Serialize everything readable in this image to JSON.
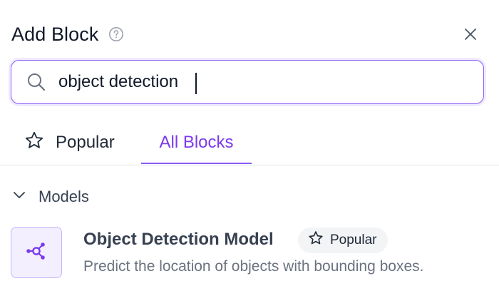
{
  "dialog": {
    "title": "Add Block",
    "help_icon": "question-circle-icon",
    "close_icon": "close-icon"
  },
  "search": {
    "value": "object detection",
    "placeholder": "",
    "icon": "search-icon"
  },
  "tabs": [
    {
      "label": "Popular",
      "icon": "star-outline-icon",
      "active": false
    },
    {
      "label": "All Blocks",
      "active": true
    }
  ],
  "section": {
    "label": "Models",
    "icon": "chevron-down-icon",
    "expanded": true
  },
  "blocks": [
    {
      "name": "Object Detection Model",
      "description": "Predict the location of objects with bounding boxes.",
      "badge": "Popular",
      "badge_icon": "star-outline-icon",
      "icon": "graph-nodes-icon"
    }
  ],
  "colors": {
    "accent": "#7c3aed",
    "accent_border": "#8b5cf6",
    "icon_tile_bg": "#f3effe",
    "badge_bg": "#f3f4f6",
    "muted_text": "#6b7280"
  }
}
